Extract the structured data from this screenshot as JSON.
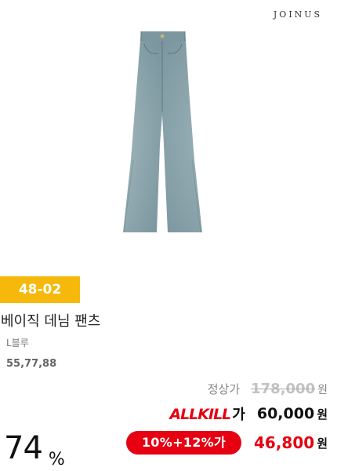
{
  "brand": {
    "name": "JOINUS"
  },
  "product": {
    "image_alt": "denim flare jeans",
    "code_badge": "48-02",
    "name": "베이직 데님 팬츠",
    "color": "L블루",
    "sizes": "55,77,88"
  },
  "pricing": {
    "list_label": "정상가",
    "list_price": "178,000",
    "allkill_logo": "ALLKILL",
    "allkill_suffix": "가",
    "allkill_price": "60,000",
    "coupon_label": "10%+12%가",
    "final_price": "46,800",
    "currency": "원",
    "discount_rate": "74",
    "discount_unit": "%"
  },
  "colors": {
    "badge": "#f6b90b",
    "accent": "#e60012",
    "denim": "#8aa4ad"
  }
}
